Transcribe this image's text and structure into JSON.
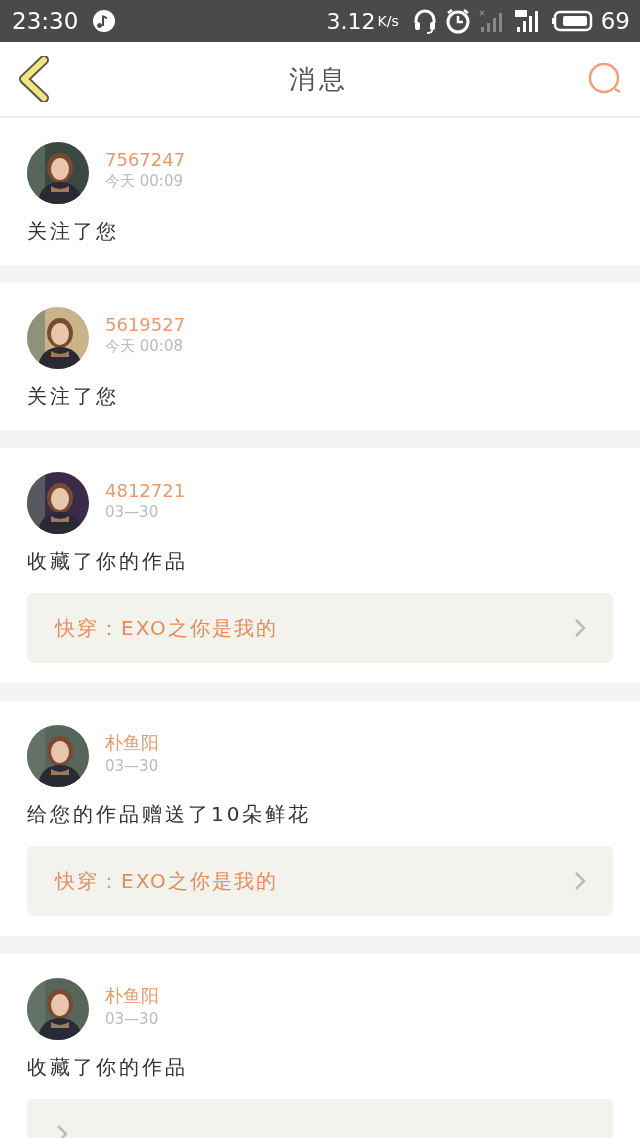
{
  "status_bar": {
    "time": "23:30",
    "speed": "3.12",
    "speed_unit": "K/s",
    "battery": "69"
  },
  "header": {
    "title": "消息"
  },
  "messages": [
    {
      "user": "7567247",
      "time": "今天  00:09",
      "text": "关注了您"
    },
    {
      "user": "5619527",
      "time": "今天  00:08",
      "text": "关注了您"
    },
    {
      "user": "4812721",
      "time": "03—30",
      "text": "收藏了你的作品",
      "work": {
        "kind": "link",
        "title": "快穿：EXO之你是我的"
      }
    },
    {
      "user": "朴鱼阳",
      "time": "03—30",
      "text": "给您的作品赠送了10朵鲜花",
      "work": {
        "kind": "link",
        "title": "快穿：EXO之你是我的"
      }
    },
    {
      "user": "朴鱼阳",
      "time": "03—30",
      "text": "收藏了你的作品",
      "work": {
        "kind": "link"
      }
    }
  ]
}
